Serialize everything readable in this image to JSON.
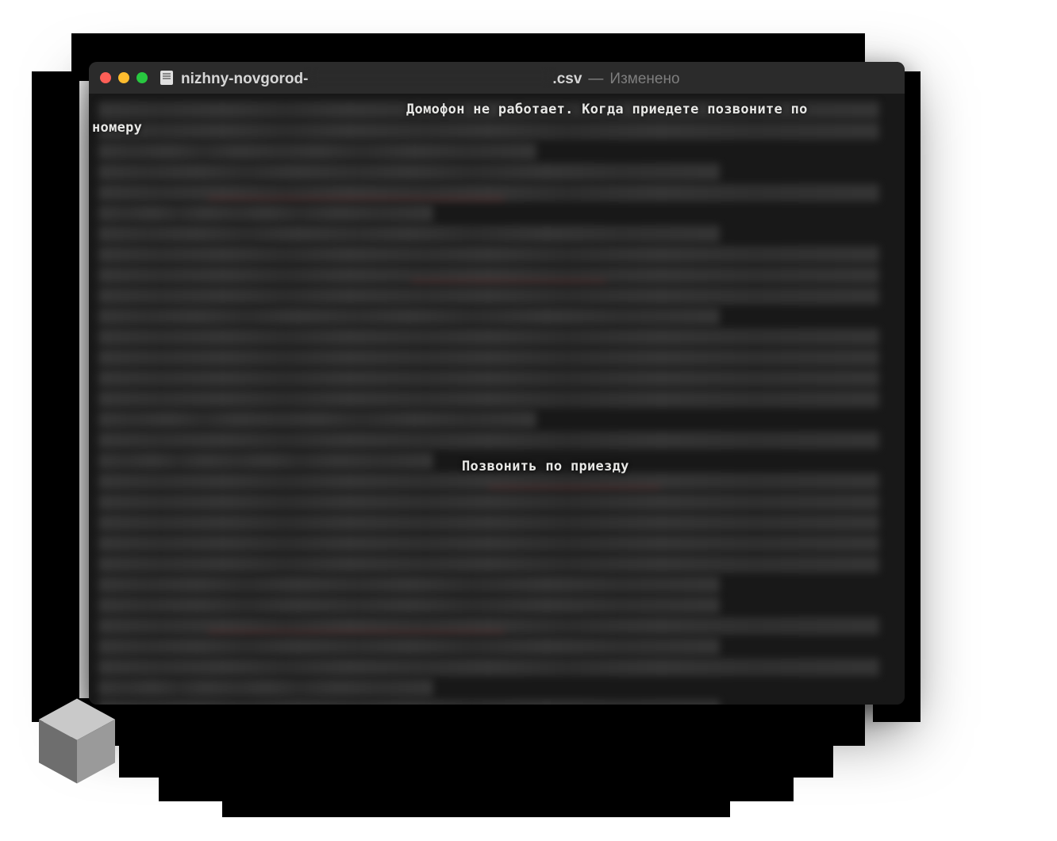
{
  "window": {
    "title_prefix": "nizhny-novgorod-",
    "title_ext": ".csv",
    "title_sep": "—",
    "title_status": "Изменено"
  },
  "visible_text": {
    "line1_part1": "Домофон не работает. Когда приедете позвоните по",
    "line1_part2": "номеру",
    "line2": "Позвонить по приезду"
  },
  "icons": {
    "close": "close-icon",
    "minimize": "minimize-icon",
    "zoom": "zoom-icon",
    "file": "file-icon",
    "cube_logo": "cube-logo"
  }
}
